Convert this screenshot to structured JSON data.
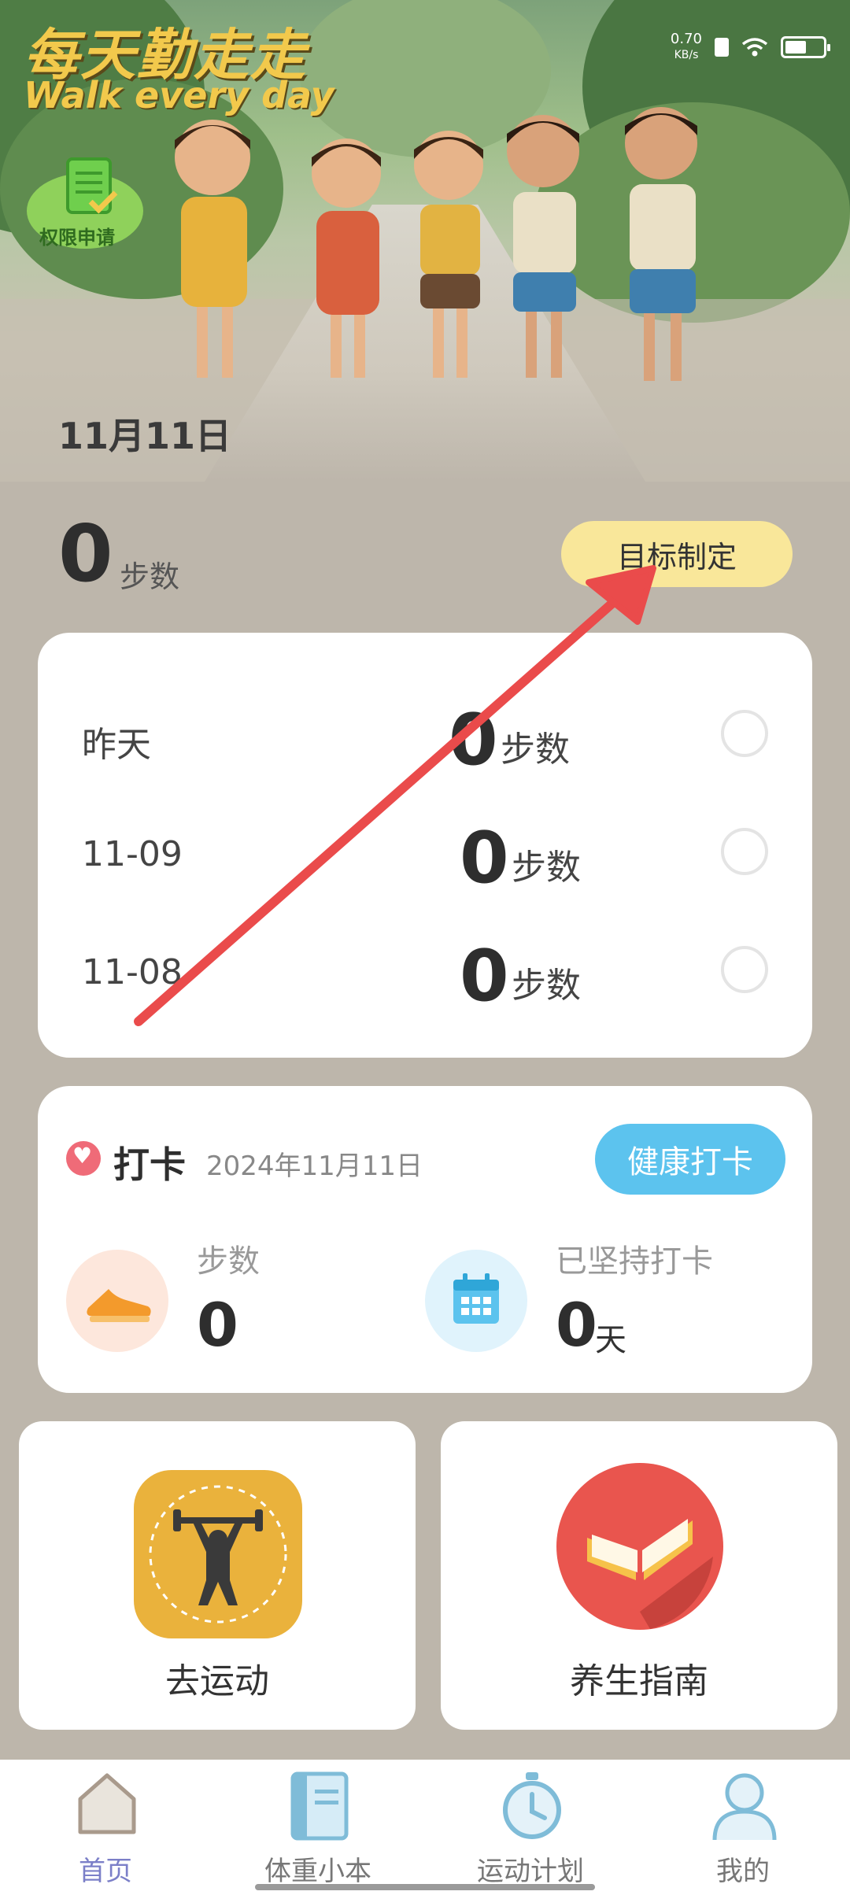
{
  "banner": {
    "title_cn": "每天勤走走",
    "title_en": "Walk every day",
    "permission_label": "权限申请",
    "date": "11月11日",
    "status": {
      "net_speed": "0.70",
      "net_unit": "KB/s"
    }
  },
  "steps": {
    "value": "0",
    "unit": "步数",
    "goal_button": "目标制定"
  },
  "history": [
    {
      "day": "昨天",
      "value": "0",
      "unit": "步数"
    },
    {
      "day": "11-09",
      "value": "0",
      "unit": "步数"
    },
    {
      "day": "11-08",
      "value": "0",
      "unit": "步数"
    }
  ],
  "checkin": {
    "title": "打卡",
    "date": "2024年11月11日",
    "health_button": "健康打卡",
    "steps_label": "步数",
    "steps_value": "0",
    "streak_label": "已坚持打卡",
    "streak_value": "0",
    "streak_unit": "天"
  },
  "tiles": {
    "exercise": "去运动",
    "health_guide": "养生指南"
  },
  "nav": {
    "home": "首页",
    "weight": "体重小本",
    "plan": "运动计划",
    "mine": "我的"
  },
  "colors": {
    "background": "#bdb6ab",
    "goal_button": "#f9e79a",
    "health_button": "#5cc3ee",
    "active_nav": "#7b7fc8",
    "annotation_arrow": "#ea4b4b"
  }
}
